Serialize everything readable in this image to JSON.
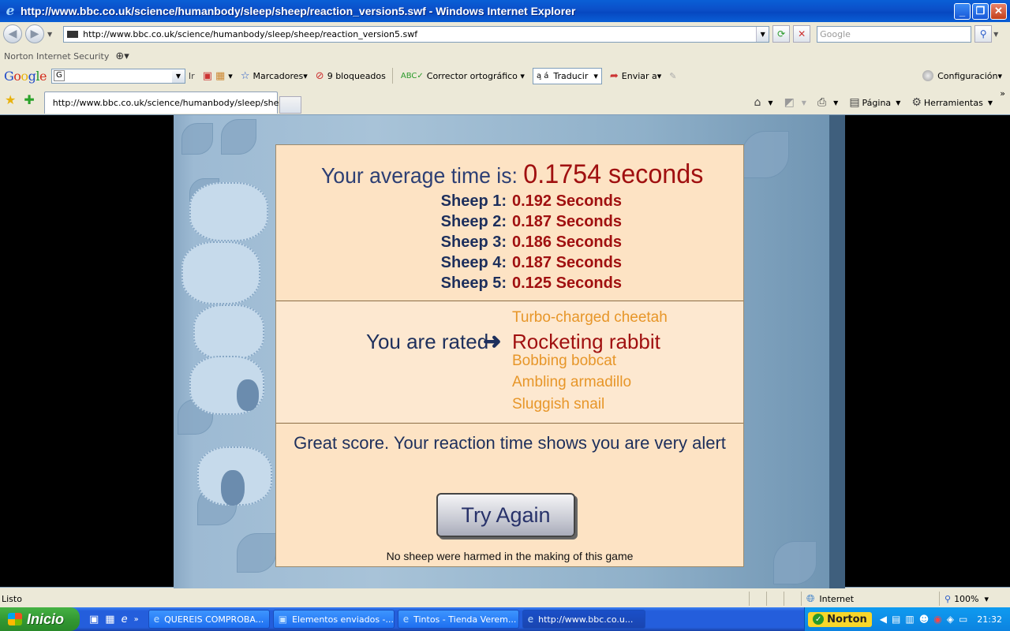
{
  "window": {
    "title": "http://www.bbc.co.uk/science/humanbody/sleep/sheep/reaction_version5.swf - Windows Internet Explorer"
  },
  "address": {
    "url": "http://www.bbc.co.uk/science/humanbody/sleep/sheep/reaction_version5.swf",
    "search_placeholder": "Google"
  },
  "norton_bar": {
    "label": "Norton Internet Security"
  },
  "google_bar": {
    "go_label": "Ir",
    "bookmarks": "Marcadores",
    "blocked": "9 bloqueados",
    "spellcheck": "Corrector ortográfico",
    "translate": "Traducir",
    "send_to": "Enviar a",
    "settings": "Configuración"
  },
  "tabs": [
    {
      "label": "http://www.bbc.co.uk/science/humanbody/sleep/she..."
    }
  ],
  "command_bar": {
    "page": "Página",
    "tools": "Herramientas"
  },
  "game": {
    "average_label": "Your average time is:",
    "average_value": "0.1754 seconds",
    "sheep": [
      {
        "label": "Sheep 1:",
        "value": "0.192 Seconds"
      },
      {
        "label": "Sheep 2:",
        "value": "0.187 Seconds"
      },
      {
        "label": "Sheep 3:",
        "value": "0.186 Seconds"
      },
      {
        "label": "Sheep 4:",
        "value": "0.187 Seconds"
      },
      {
        "label": "Sheep 5:",
        "value": "0.125 Seconds"
      }
    ],
    "rated_label": "You are rated",
    "ranks": [
      "Turbo-charged cheetah",
      "Rocketing rabbit",
      "Bobbing bobcat",
      "Ambling armadillo",
      "Sluggish snail"
    ],
    "current_rank_index": 1,
    "verdict": "Great score. Your reaction time shows you are very alert",
    "try_again": "Try Again",
    "footer": "No sheep were harmed in the making of this game"
  },
  "status": {
    "text": "Listo",
    "zone": "Internet",
    "zoom": "100%"
  },
  "taskbar": {
    "start": "Inicio",
    "buttons": [
      "QUEREIS COMPROBA...",
      "Elementos enviados -...",
      "Tintos - Tienda Verem...",
      "http://www.bbc.co.u..."
    ],
    "norton": "Norton",
    "clock": "21:32"
  },
  "colors": {
    "panel_bg": "#fde3c4",
    "value_red": "#a01010",
    "navy": "#1d2f5c",
    "rank_orange": "#e79629"
  }
}
